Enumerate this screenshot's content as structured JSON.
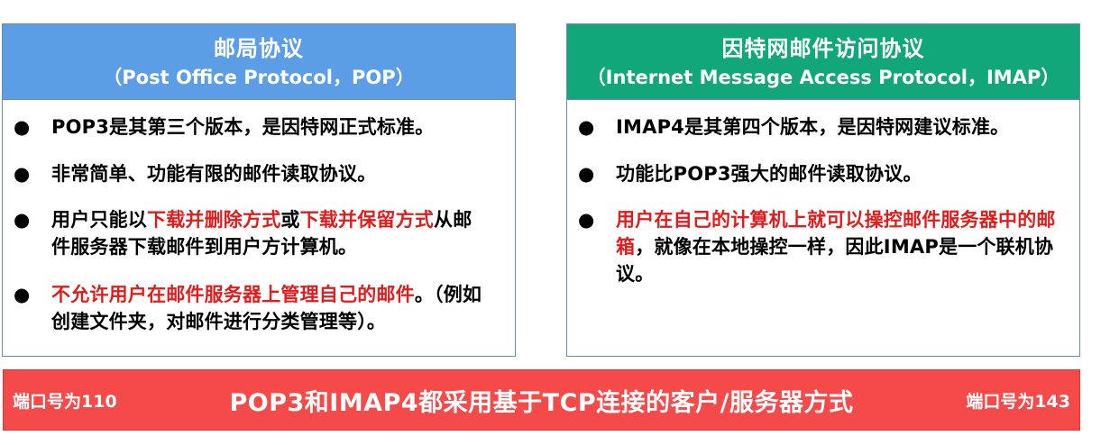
{
  "pop": {
    "title": "邮局协议",
    "subtitle": "（Post Office Protocol，POP）",
    "items": [
      {
        "parts": [
          {
            "text": "POP3是其第三个版本，是因特网正式标准。",
            "red": false
          }
        ]
      },
      {
        "parts": [
          {
            "text": "非常简单、功能有限的邮件读取协议。",
            "red": false
          }
        ]
      },
      {
        "parts": [
          {
            "text": "用户只能以",
            "red": false
          },
          {
            "text": "下载并删除方式",
            "red": true
          },
          {
            "text": "或",
            "red": false
          },
          {
            "text": "下载并保留方式",
            "red": true
          },
          {
            "text": "从邮件服务器下载邮件到用户方计算机。",
            "red": false
          }
        ]
      },
      {
        "parts": [
          {
            "text": "不允许用户在邮件服务器上管理自己的邮件",
            "red": true
          },
          {
            "text": "。（例如创建文件夹，对邮件进行分类管理等）。",
            "red": false
          }
        ]
      }
    ]
  },
  "imap": {
    "title": "因特网邮件访问协议",
    "subtitle": "（Internet Message Access Protocol，IMAP）",
    "items": [
      {
        "parts": [
          {
            "text": "IMAP4是其第四个版本，是因特网建议标准。",
            "red": false
          }
        ]
      },
      {
        "parts": [
          {
            "text": "功能比POP3强大的邮件读取协议。",
            "red": false
          }
        ]
      },
      {
        "parts": [
          {
            "text": "用户在自己的计算机上就可以操控邮件服务器中的邮箱",
            "red": true
          },
          {
            "text": "，就像在本地操控一样，因此IMAP是一个联机协议。",
            "red": false
          }
        ]
      }
    ]
  },
  "bottom": {
    "left_port": "端口号为110",
    "title": "POP3和IMAP4都采用基于TCP连接的客户/服务器方式",
    "right_port": "端口号为143"
  },
  "colors": {
    "pop_header": "#5b9ee6",
    "imap_header": "#12a77a",
    "bottom_bar": "#f54a4a",
    "highlight": "#e31b1b"
  }
}
